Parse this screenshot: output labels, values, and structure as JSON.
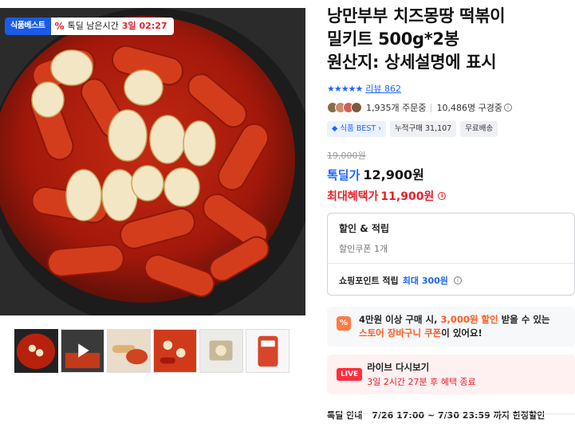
{
  "image_badges": {
    "best_label": "식품베스트",
    "timer_icon": "%",
    "timer_label": "톡딜 남은시간",
    "timer_days": "3일",
    "timer_clock": "02:27"
  },
  "thumbnails": [
    {
      "name": "thumb-1",
      "active": true
    },
    {
      "name": "thumb-2-video"
    },
    {
      "name": "thumb-3"
    },
    {
      "name": "thumb-4"
    },
    {
      "name": "thumb-5"
    },
    {
      "name": "thumb-6"
    }
  ],
  "product": {
    "title_line1": "낭만부부 치즈몽땅 떡볶이",
    "title_line2": "밀키트 500g*2봉",
    "title_line3": "원산지: 상세설명에 표시",
    "stars": "★★★★★",
    "review_label": "리뷰 862",
    "orders": "1,935개 주문중",
    "watchers": "10,486명 구경중"
  },
  "tags": {
    "best": "식품 BEST",
    "cumulative": "누적구매 31,107",
    "shipping": "무료배송"
  },
  "price": {
    "original": "19,000원",
    "deal_label": "톡딜가",
    "deal_price": "12,900원",
    "max_label": "최대혜택가",
    "max_price": "11,900원"
  },
  "discount_box": {
    "title": "할인 & 적립",
    "coupon": "할인쿠폰 1개",
    "point_prefix": "쇼핑포인트 적립",
    "point_max": "최대 300원"
  },
  "promo": {
    "icon": "%",
    "text_a": "4만원 이상 구매 시, ",
    "text_b": "3,000원 할인",
    "text_c": " 받을 수 있는",
    "text_d": "스토어 장바구니 쿠폰",
    "text_e": "이 있어요!"
  },
  "live": {
    "badge": "LIVE",
    "title": "라이브 다시보기",
    "subtitle": "3일 2시간 27분 후 혜택 종료"
  },
  "deal_info": {
    "label": "톡딜 안내",
    "period": "7/26 17:00 ~ 7/30 23:59 까지 한정할인"
  },
  "colors": {
    "accent_blue": "#1e64ff",
    "deal_red": "#e8202a",
    "promo_orange": "#ff5a1f",
    "live_red": "#ff2c3c"
  }
}
